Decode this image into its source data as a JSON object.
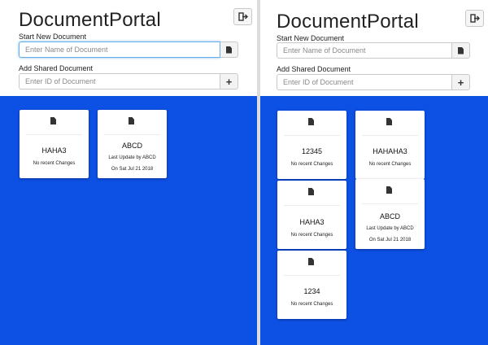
{
  "app": {
    "title": "DocumentPortal"
  },
  "start_new": {
    "label": "Start New Document",
    "placeholder": "Enter Name of Document"
  },
  "add_shared": {
    "label": "Add Shared Document",
    "placeholder": "Enter ID of Document",
    "add_symbol": "+"
  },
  "icons": {
    "logout": "sign-out-icon",
    "document": "file-icon",
    "add": "plus-icon"
  },
  "colors": {
    "background_blue": "#0d50e4",
    "focus": "#66afe9"
  },
  "left_documents": [
    {
      "name": "HAHA3",
      "lines": [
        "No recent Changes"
      ]
    },
    {
      "name": "ABCD",
      "lines": [
        "Last Update by ABCD",
        "On Sat Jul 21 2018"
      ]
    }
  ],
  "right_documents": [
    {
      "name": "12345",
      "lines": [
        "No recent Changes"
      ]
    },
    {
      "name": "HAHAHA3",
      "lines": [
        "No recent Changes"
      ]
    },
    {
      "name": "HAHA3",
      "lines": [
        "No recent Changes"
      ]
    },
    {
      "name": "ABCD",
      "lines": [
        "Last Update by ABCD",
        "On Sat Jul 21 2018"
      ]
    },
    {
      "name": "1234",
      "lines": [
        "No recent Changes"
      ]
    }
  ]
}
